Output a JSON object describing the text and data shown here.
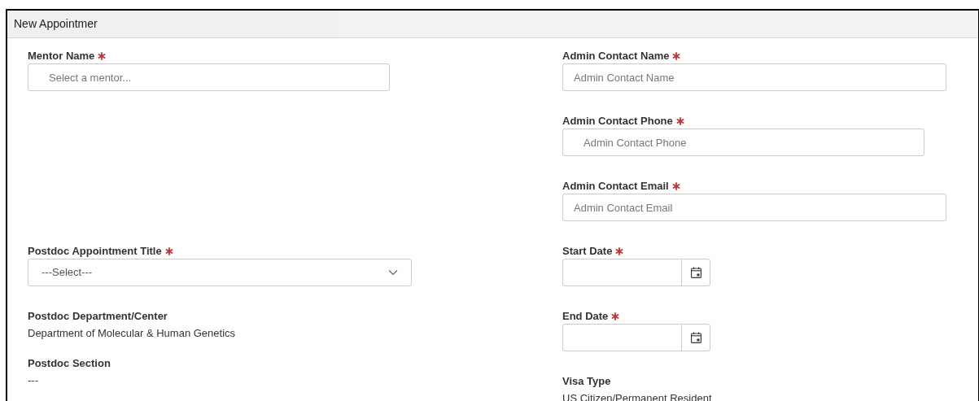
{
  "window": {
    "title": "New Appointmer"
  },
  "top_left": [
    {
      "kind": "lookup",
      "label": "Mentor Name",
      "required": true,
      "placeholder": "Select a mentor..."
    }
  ],
  "top_right": [
    {
      "kind": "text",
      "label": "Admin Contact Name",
      "required": true,
      "placeholder": "Admin Contact Name"
    },
    {
      "kind": "phone",
      "label": "Admin Contact Phone",
      "required": true,
      "placeholder": "Admin Contact Phone"
    },
    {
      "kind": "text",
      "label": "Admin Contact Email",
      "required": true,
      "placeholder": "Admin Contact Email"
    }
  ],
  "bottom_left": [
    {
      "kind": "select",
      "label": "Postdoc Appointment Title",
      "required": true,
      "value": "---Select---"
    },
    {
      "kind": "readonly",
      "label": "Postdoc Department/Center",
      "required": false,
      "value": "Department of Molecular & Human Genetics"
    },
    {
      "kind": "readonly",
      "label": "Postdoc Section",
      "required": false,
      "value": "---"
    }
  ],
  "bottom_right": [
    {
      "kind": "date",
      "label": "Start Date",
      "required": true
    },
    {
      "kind": "date",
      "label": "End Date",
      "required": true
    },
    {
      "kind": "readonly",
      "label": "Visa Type",
      "required": false,
      "value": "US Citizen/Permanent Resident"
    }
  ]
}
